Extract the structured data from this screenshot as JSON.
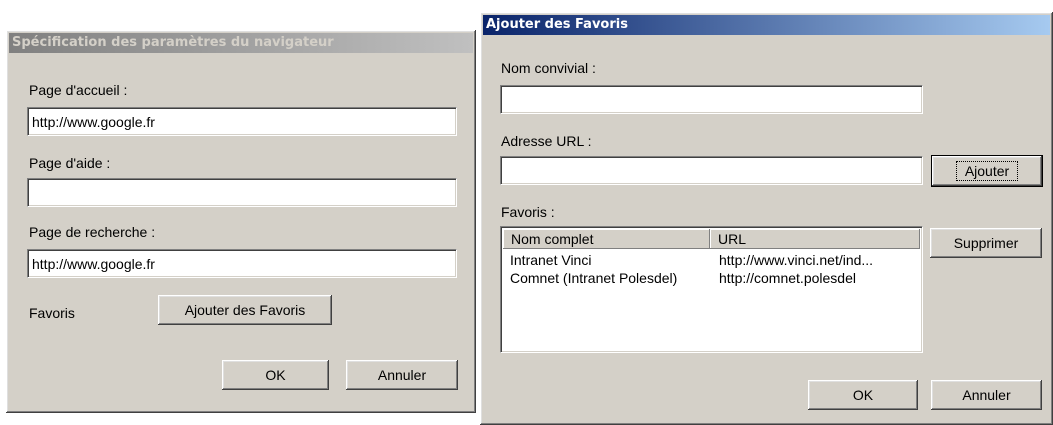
{
  "browser_dialog": {
    "title": "Spécification des paramètres du navigateur",
    "home_label": "Page d'accueil :",
    "home_value": "http://www.google.fr",
    "help_label": "Page d'aide :",
    "help_value": "",
    "search_label": "Page de recherche :",
    "search_value": "http://www.google.fr",
    "favorites_label": "Favoris",
    "add_favorites_button": "Ajouter des Favoris",
    "ok_button": "OK",
    "cancel_button": "Annuler"
  },
  "favorites_dialog": {
    "title": "Ajouter des Favoris",
    "friendly_name_label": "Nom convivial :",
    "friendly_name_value": "",
    "url_label": "Adresse URL :",
    "url_value": "",
    "add_button": "Ajouter",
    "favorites_label": "Favoris :",
    "columns": [
      "Nom complet",
      "URL"
    ],
    "rows": [
      {
        "name": "Intranet Vinci",
        "url": "http://www.vinci.net/ind..."
      },
      {
        "name": "Comnet (Intranet Polesdel)",
        "url": "http://comnet.polesdel"
      }
    ],
    "delete_button": "Supprimer",
    "ok_button": "OK",
    "cancel_button": "Annuler"
  }
}
